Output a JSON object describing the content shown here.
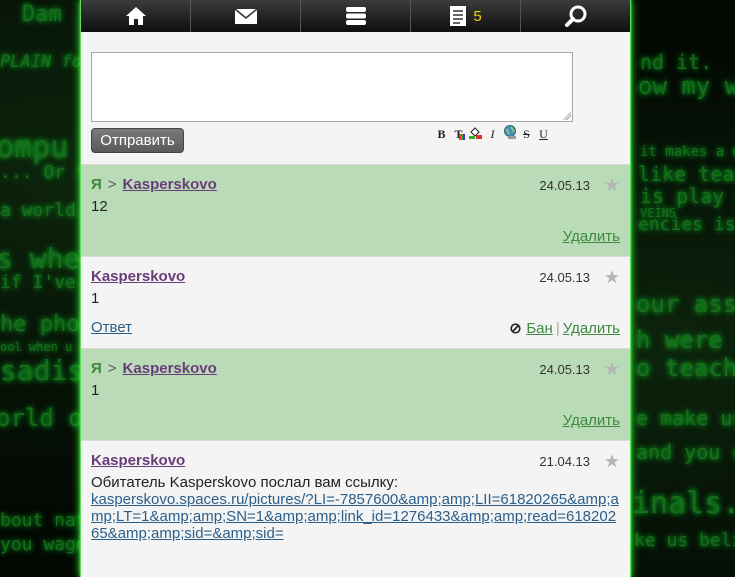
{
  "background": {
    "snippets": [
      "Dam",
      "PLAIN for",
      "ompu",
      "... Or fee",
      "a world...",
      "s whe",
      "if I've r",
      "he phon",
      "ool when u",
      "sadist",
      "orld of",
      "bout nati",
      "you wage",
      "nd it.",
      "ow my wo",
      "it makes a mis",
      "like teachi",
      "is play ga",
      "VEINS",
      "encies is so",
      "our ass u",
      "h were y",
      "o teach",
      "e make use",
      "and you c",
      "inals.",
      "ke us belie"
    ]
  },
  "nav": {
    "tabs": [
      {
        "name": "home",
        "icon": "home-icon"
      },
      {
        "name": "mail",
        "icon": "envelope-icon"
      },
      {
        "name": "forums",
        "icon": "stack-icon"
      },
      {
        "name": "journal",
        "icon": "document-icon",
        "count": "5"
      },
      {
        "name": "search",
        "icon": "search-icon"
      }
    ]
  },
  "composer": {
    "text": "",
    "send_label": "Отправить",
    "format_buttons": [
      "B",
      "T",
      "",
      "I",
      "",
      "S",
      "U"
    ]
  },
  "messages": [
    {
      "type": "own",
      "me": "Я",
      "arrow": ">",
      "author": "Kasperskovo",
      "date": "24.05.13",
      "text": "12",
      "delete": "Удалить"
    },
    {
      "type": "in",
      "author": "Kasperskovo",
      "date": "24.05.13",
      "text": "1",
      "reply": "Ответ",
      "ban": "Бан",
      "delete": "Удалить"
    },
    {
      "type": "own",
      "me": "Я",
      "arrow": ">",
      "author": "Kasperskovo",
      "date": "24.05.13",
      "text": "1",
      "delete": "Удалить"
    },
    {
      "type": "in",
      "author": "Kasperskovo",
      "date": "21.04.13",
      "text": "Обитатель Kasperskovo послал вам ссылку:",
      "link": "kasperskovo.spaces.ru/pictures/?LI=-7857600&amp;amp;LII=61820265&amp;amp;LT=1&amp;amp;SN=1&amp;amp;link_id=1276433&amp;amp;read=61820265&amp;amp;sid=&amp;sid="
    }
  ],
  "colors": {
    "own_bg": "#b9dbb8",
    "in_bg": "#f4f4f4",
    "accent": "#3f8a3f",
    "author": "#6a3c7a"
  }
}
